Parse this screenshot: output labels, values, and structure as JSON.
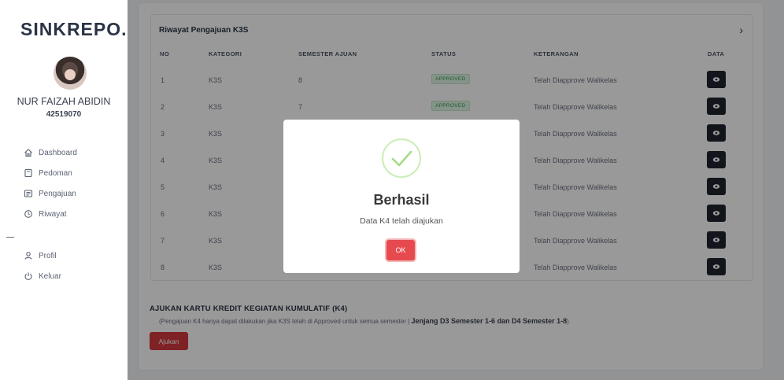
{
  "brand": "SINKREPO.",
  "user": {
    "name": "NUR FAIZAH ABIDIN",
    "nim": "42519070"
  },
  "nav": {
    "items": [
      {
        "label": "Dashboard",
        "icon": "home-icon"
      },
      {
        "label": "Pedoman",
        "icon": "book-icon"
      },
      {
        "label": "Pengajuan",
        "icon": "list-icon"
      },
      {
        "label": "Riwayat",
        "icon": "history-icon"
      }
    ],
    "items2": [
      {
        "label": "Profil",
        "icon": "user-icon"
      },
      {
        "label": "Keluar",
        "icon": "power-icon"
      }
    ]
  },
  "table": {
    "title": "Riwayat Pengajuan K3S",
    "headers": {
      "no": "NO",
      "kategori": "KATEGORI",
      "semester": "SEMESTER AJUAN",
      "status": "STATUS",
      "keterangan": "KETERANGAN",
      "data": "DATA"
    },
    "rows": [
      {
        "no": "1",
        "kategori": "K3S",
        "semester": "8",
        "status": "APPROVED",
        "keterangan": "Telah Diapprove Walikelas"
      },
      {
        "no": "2",
        "kategori": "K3S",
        "semester": "7",
        "status": "APPROVED",
        "keterangan": "Telah Diapprove Walikelas"
      },
      {
        "no": "3",
        "kategori": "K3S",
        "semester": "",
        "status": "",
        "keterangan": "Telah Diapprove Walikelas"
      },
      {
        "no": "4",
        "kategori": "K3S",
        "semester": "",
        "status": "",
        "keterangan": "Telah Diapprove Walikelas"
      },
      {
        "no": "5",
        "kategori": "K3S",
        "semester": "",
        "status": "",
        "keterangan": "Telah Diapprove Walikelas"
      },
      {
        "no": "6",
        "kategori": "K3S",
        "semester": "",
        "status": "",
        "keterangan": "Telah Diapprove Walikelas"
      },
      {
        "no": "7",
        "kategori": "K3S",
        "semester": "",
        "status": "",
        "keterangan": "Telah Diapprove Walikelas"
      },
      {
        "no": "8",
        "kategori": "K3S",
        "semester": "",
        "status": "",
        "keterangan": "Telah Diapprove Walikelas"
      }
    ]
  },
  "k4": {
    "title": "AJUKAN KARTU KREDIT KEGIATAN KUMULATIF (K4)",
    "note_prefix": "(Pengajuan K4 hanya dapat dilakukan jika K3S telah di Approved untuk semua semester | ",
    "note_bold": "Jenjang D3 Semester 1-6 dan D4 Semester 1-8",
    "note_suffix": ")",
    "button": "Ajukan"
  },
  "modal": {
    "title": "Berhasil",
    "text": "Data K4 telah diajukan",
    "ok": "OK"
  },
  "colors": {
    "primary_red": "#d23a3f",
    "ok_red": "#e64a4f",
    "success_green": "#a5dc86",
    "dark_button": "#1f2530"
  }
}
